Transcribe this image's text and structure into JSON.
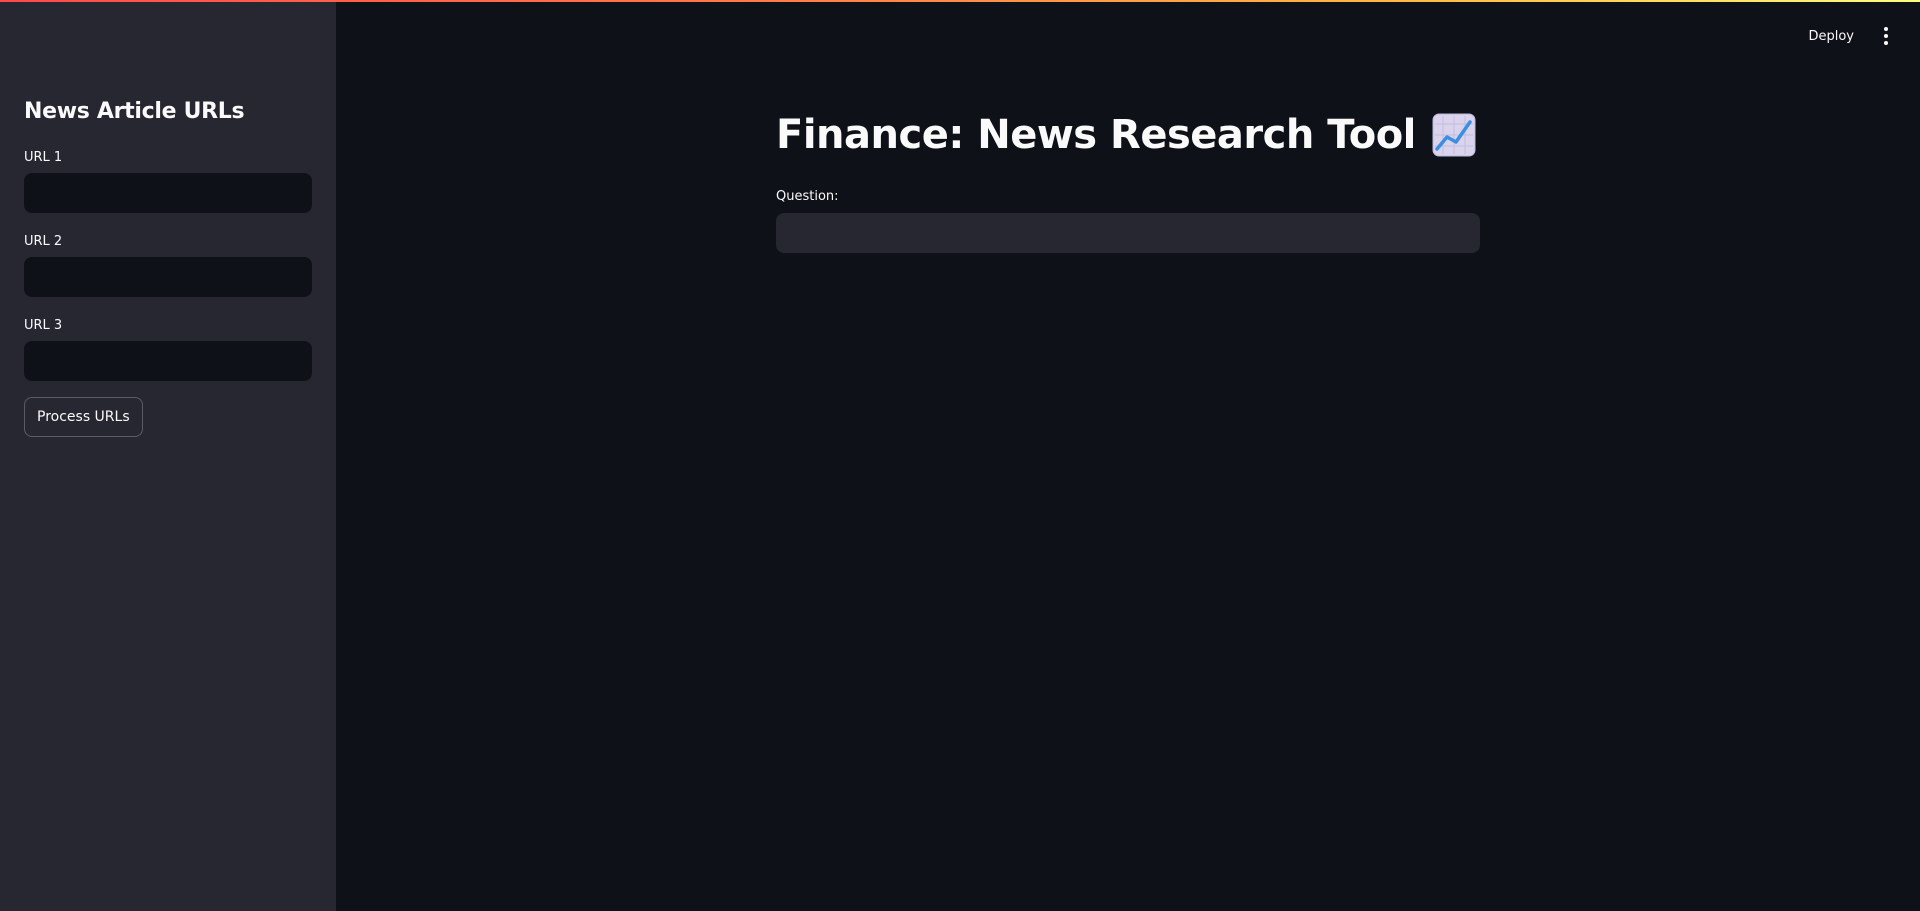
{
  "header": {
    "deploy_label": "Deploy",
    "menu_icon": "vertical-ellipsis-icon"
  },
  "sidebar": {
    "title": "News Article URLs",
    "fields": [
      {
        "label": "URL 1",
        "value": ""
      },
      {
        "label": "URL 2",
        "value": ""
      },
      {
        "label": "URL 3",
        "value": ""
      }
    ],
    "process_button_label": "Process URLs"
  },
  "main": {
    "title": "Finance: News Research Tool",
    "title_icon": "chart-increasing-icon",
    "question_label": "Question:",
    "question_value": ""
  },
  "colors": {
    "background": "#0e1117",
    "sidebar_background": "#262730",
    "text": "#fafafa",
    "decoration_start": "#ff4b4b",
    "decoration_end": "#fffd80"
  }
}
